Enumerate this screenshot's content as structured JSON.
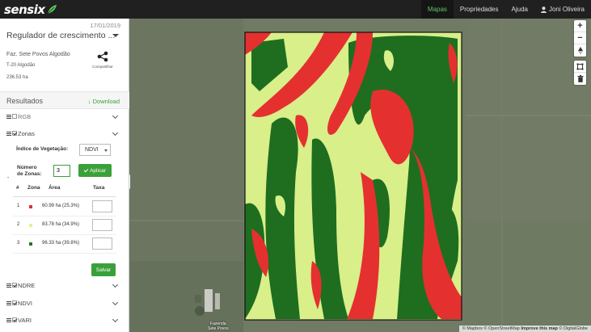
{
  "app": {
    "logo_text": "sensix",
    "nav": {
      "maps": "Mapas",
      "properties": "Propriedades",
      "help": "Ajuda",
      "user": "Joni Oliveira"
    }
  },
  "sidebar": {
    "date": "17/01/2019",
    "map_title": "Regulador de crescimento ...",
    "farm": "Faz. Sete Povos Algodão",
    "field": "T-20 Algodão",
    "area": "236.53 ha",
    "share_label": "Compartilhar",
    "results_title": "Resultados",
    "download_label": "Download",
    "layers": {
      "rgb": "RGB",
      "zones": "Zonas",
      "ndre": "NDRE",
      "ndvi": "NDVI",
      "vari": "VARI"
    },
    "zones_panel": {
      "veg_index_label": "Índice de Vegetação:",
      "veg_index_value": "NDVI",
      "zones_count_label_1": "Número",
      "zones_count_label_2": "de Zonas:",
      "zones_count_value": "3",
      "apply_label": "Aplicar",
      "headers": [
        "#",
        "Zona",
        "Área",
        "Taxa"
      ],
      "rows": [
        {
          "num": "1",
          "color": "#e03030",
          "area": "60.99 ha (25.3%)"
        },
        {
          "num": "2",
          "color": "#e8f08a",
          "area": "83.78 ha (34.9%)"
        },
        {
          "num": "3",
          "color": "#1e7a1e",
          "area": "96.33 ha (39.8%)"
        }
      ],
      "save_label": "Salvar"
    }
  },
  "map": {
    "zone_colors": {
      "low": "#e53030",
      "mid": "#d8ef8a",
      "high": "#1f6e1f"
    },
    "place_label_1": "Fazenda",
    "place_label_2": "Sete Povos",
    "attribution": {
      "mapbox": "© Mapbox",
      "osm": "© OpenStreetMap",
      "improve": "Improve this map",
      "digitalglobe": "© DigitalGlobe"
    },
    "controls": [
      "zoom-in",
      "zoom-out",
      "compass",
      "draw-polygon",
      "delete"
    ]
  }
}
